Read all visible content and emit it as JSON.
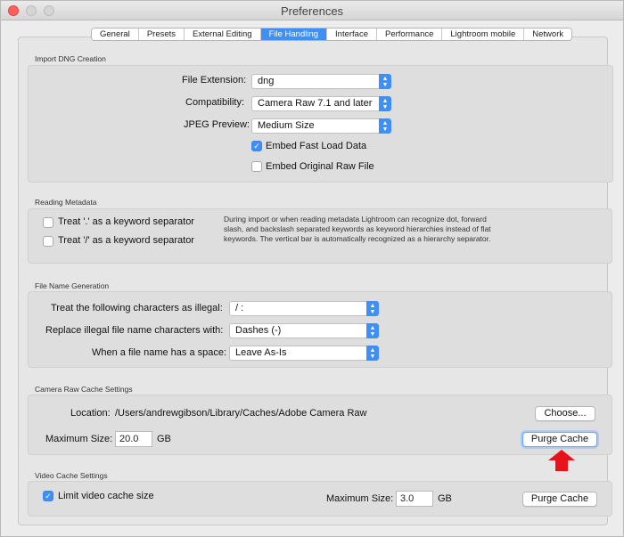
{
  "window": {
    "title": "Preferences"
  },
  "tabs": [
    {
      "label": "General",
      "active": false
    },
    {
      "label": "Presets",
      "active": false
    },
    {
      "label": "External Editing",
      "active": false
    },
    {
      "label": "File Handling",
      "active": true
    },
    {
      "label": "Interface",
      "active": false
    },
    {
      "label": "Performance",
      "active": false
    },
    {
      "label": "Lightroom mobile",
      "active": false
    },
    {
      "label": "Network",
      "active": false
    }
  ],
  "import_dng": {
    "title": "Import DNG Creation",
    "file_extension_label": "File Extension:",
    "file_extension_value": "dng",
    "compatibility_label": "Compatibility:",
    "compatibility_value": "Camera Raw 7.1 and later",
    "jpeg_preview_label": "JPEG Preview:",
    "jpeg_preview_value": "Medium Size",
    "embed_fast_load_label": "Embed Fast Load Data",
    "embed_fast_load_checked": true,
    "embed_original_label": "Embed Original Raw File",
    "embed_original_checked": false
  },
  "reading_metadata": {
    "title": "Reading Metadata",
    "dot_label": "Treat '.' as a keyword separator",
    "dot_checked": false,
    "slash_label": "Treat '/' as a keyword separator",
    "slash_checked": false,
    "description": "During import or when reading metadata Lightroom can recognize dot, forward slash, and backslash separated keywords as keyword hierarchies instead of flat keywords. The vertical bar is automatically recognized as a hierarchy separator."
  },
  "file_name_generation": {
    "title": "File Name Generation",
    "illegal_label": "Treat the following characters as illegal:",
    "illegal_value": "/ :",
    "replace_label": "Replace illegal file name characters with:",
    "replace_value": "Dashes (-)",
    "space_label": "When a file name has a space:",
    "space_value": "Leave As-Is"
  },
  "camera_raw_cache": {
    "title": "Camera Raw Cache Settings",
    "location_label": "Location:",
    "location_value": "/Users/andrewgibson/Library/Caches/Adobe Camera Raw",
    "choose_label": "Choose...",
    "max_size_label": "Maximum Size:",
    "max_size_value": "20.0",
    "unit": "GB",
    "purge_label": "Purge Cache"
  },
  "video_cache": {
    "title": "Video Cache Settings",
    "limit_label": "Limit video cache size",
    "limit_checked": true,
    "max_size_label": "Maximum Size:",
    "max_size_value": "3.0",
    "unit": "GB",
    "purge_label": "Purge Cache"
  },
  "colors": {
    "accent": "#3f8ff6",
    "annotation_arrow": "#e8131a"
  }
}
